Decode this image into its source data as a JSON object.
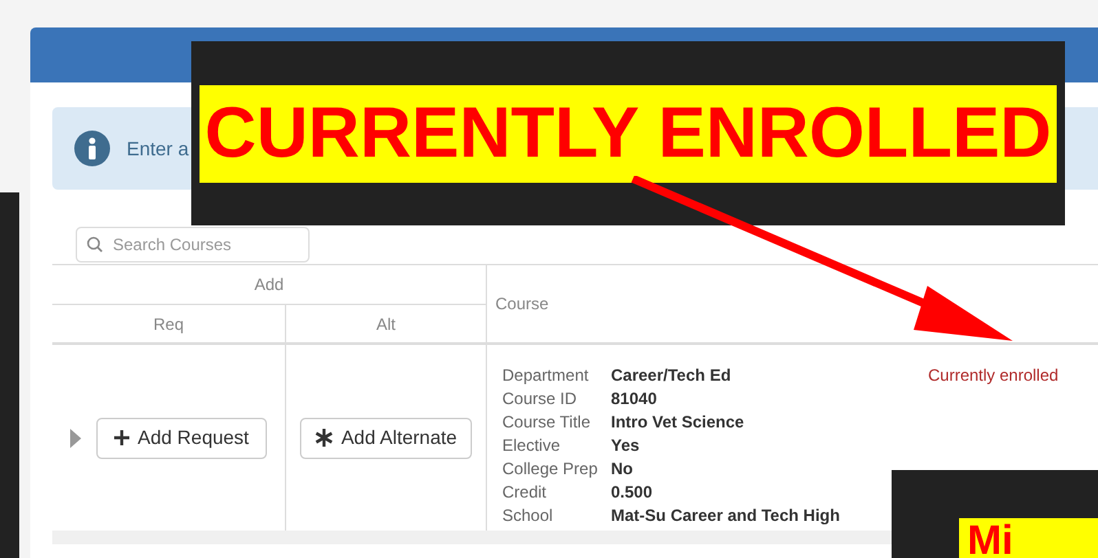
{
  "alert": {
    "text": "Enter a"
  },
  "search": {
    "placeholder": "Search Courses"
  },
  "table": {
    "group_header": "Add",
    "columns": [
      "Req",
      "Alt"
    ],
    "course_header": "Course",
    "rows": [
      {
        "expanded": false,
        "request_button": "Add Request",
        "alternate_button": "Add Alternate",
        "status": "Currently enrolled",
        "details": [
          {
            "label": "Department",
            "value": "Career/Tech Ed"
          },
          {
            "label": "Course ID",
            "value": "81040"
          },
          {
            "label": "Course Title",
            "value": "Intro Vet Science"
          },
          {
            "label": "Elective",
            "value": "Yes"
          },
          {
            "label": "College Prep",
            "value": "No"
          },
          {
            "label": "Credit",
            "value": "0.500"
          },
          {
            "label": "School",
            "value": "Mat-Su Career and Tech High"
          }
        ]
      }
    ]
  },
  "annotations": [
    {
      "kind": "callout",
      "text": "CURRENTLY ENROLLED"
    },
    {
      "kind": "callout-small",
      "text": "Mi"
    }
  ]
}
